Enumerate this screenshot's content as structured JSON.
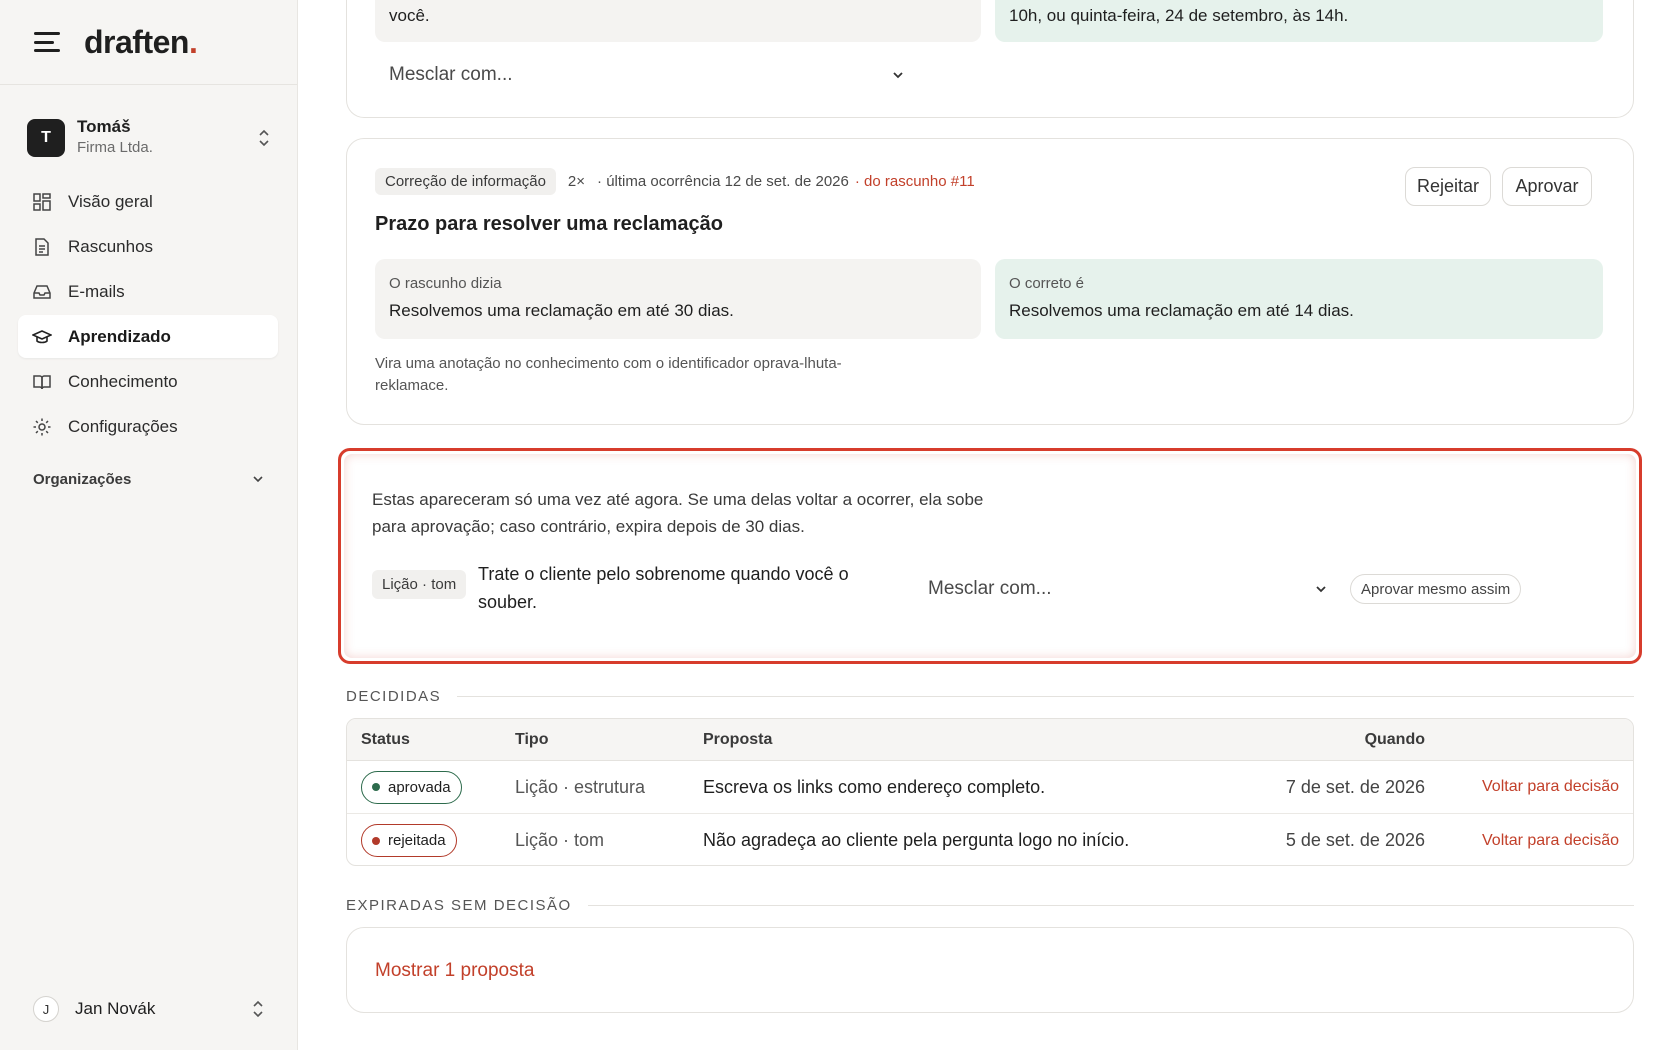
{
  "brand": {
    "name": "draften",
    "dot": "."
  },
  "account": {
    "initial": "T",
    "name": "Tomáš",
    "org": "Firma Ltda."
  },
  "nav": [
    {
      "label": "Visão geral",
      "icon": "grid-icon"
    },
    {
      "label": "Rascunhos",
      "icon": "document-icon"
    },
    {
      "label": "E-mails",
      "icon": "inbox-icon"
    },
    {
      "label": "Aprendizado",
      "icon": "graduation-cap-icon",
      "active": true
    },
    {
      "label": "Conhecimento",
      "icon": "book-icon"
    },
    {
      "label": "Configurações",
      "icon": "gear-icon"
    }
  ],
  "organizations_label": "Organizações",
  "user": {
    "initial": "J",
    "name": "Jan Novák"
  },
  "card1": {
    "left_text": "você.",
    "right_text": "10h, ou quinta-feira, 24 de setembro, às 14h.",
    "merge_placeholder": "Mesclar com..."
  },
  "card2": {
    "chip": "Correção de informação",
    "count": "2×",
    "last_occurrence": "· última ocorrência 12 de set. de 2026",
    "source_link": "· do rascunho #11",
    "reject_label": "Rejeitar",
    "approve_label": "Aprovar",
    "title": "Prazo para resolver uma reclamação",
    "draft_label": "O rascunho dizia",
    "draft_text": "Resolvemos uma reclamação em até 30 dias.",
    "correct_label": "O correto é",
    "correct_text": "Resolvemos uma reclamação em até 14 dias.",
    "footnote": "Vira uma anotação no conhecimento com o identificador oprava-lhuta-reklamace."
  },
  "card3": {
    "intro": "Estas apareceram só uma vez até agora. Se uma delas voltar a ocorrer, ela sobe para aprovação; caso contrário, expira depois de 30 dias.",
    "lesson_chip": "Lição · tom",
    "lesson_text": "Trate o cliente pelo sobrenome quando você o souber.",
    "merge_placeholder": "Mesclar com...",
    "approve_anyway": "Aprovar mesmo assim"
  },
  "decided": {
    "section_label": "DECIDIDAS",
    "headers": {
      "status": "Status",
      "tipo": "Tipo",
      "proposta": "Proposta",
      "quando": "Quando"
    },
    "rows": [
      {
        "status": "aprovada",
        "tipo": "Lição · estrutura",
        "proposta": "Escreva os links como endereço completo.",
        "quando": "7 de set. de 2026",
        "action": "Voltar para decisão"
      },
      {
        "status": "rejeitada",
        "tipo": "Lição · tom",
        "proposta": "Não agradeça ao cliente pela pergunta logo no início.",
        "quando": "5 de set. de 2026",
        "action": "Voltar para decisão"
      }
    ]
  },
  "expired": {
    "section_label": "EXPIRADAS SEM DECISÃO",
    "show_link": "Mostrar 1 proposta"
  },
  "colors": {
    "accent": "#c2402a",
    "approved": "#2d6b4c",
    "rejected": "#b23a2a",
    "highlight": "#d73c2c"
  }
}
